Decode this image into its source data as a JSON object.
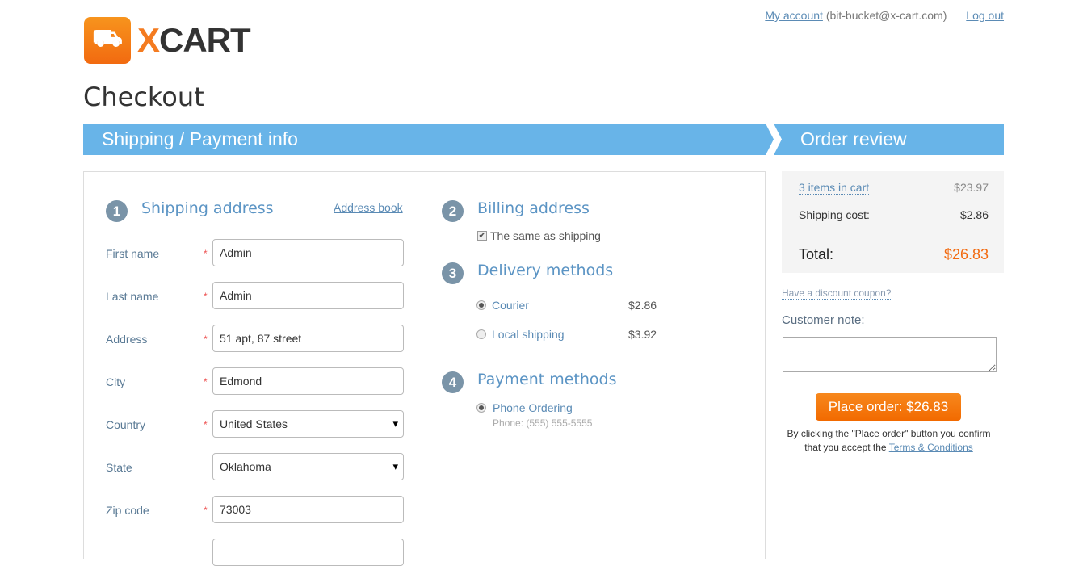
{
  "header": {
    "my_account": "My account",
    "email": "(bit-bucket@x-cart.com)",
    "logout": "Log out",
    "logo_x": "X",
    "logo_cart": "CART"
  },
  "page_title": "Checkout",
  "steps": {
    "step1": "Shipping / Payment info",
    "step2": "Order review"
  },
  "shipping": {
    "num": "1",
    "title": "Shipping address",
    "address_book": "Address book",
    "fields": [
      {
        "label": "First name",
        "value": "Admin",
        "required": true
      },
      {
        "label": "Last name",
        "value": "Admin",
        "required": true
      },
      {
        "label": "Address",
        "value": "51 apt, 87 street",
        "required": true
      },
      {
        "label": "City",
        "value": "Edmond",
        "required": true
      },
      {
        "label": "Country",
        "value": "United States",
        "required": true
      },
      {
        "label": "State",
        "value": "Oklahoma",
        "required": false
      },
      {
        "label": "Zip code",
        "value": "73003",
        "required": true
      }
    ],
    "req_mark": "*"
  },
  "billing": {
    "num": "2",
    "title": "Billing address",
    "same": "The same as shipping"
  },
  "delivery": {
    "num": "3",
    "title": "Delivery methods",
    "options": [
      {
        "label": "Courier",
        "price": "$2.86",
        "selected": true
      },
      {
        "label": "Local shipping",
        "price": "$3.92",
        "selected": false
      }
    ]
  },
  "payment": {
    "num": "4",
    "title": "Payment methods",
    "option": "Phone Ordering",
    "note": "Phone: (555) 555-5555"
  },
  "summary": {
    "items": "3 items in cart",
    "items_price": "$23.97",
    "shipping_label": "Shipping cost:",
    "shipping_price": "$2.86",
    "total_label": "Total:",
    "total": "$26.83"
  },
  "coupon": "Have a discount coupon?",
  "note_label": "Customer note:",
  "place_order": "Place order: $26.83",
  "confirm_text": "By clicking the \"Place order\" button you confirm",
  "confirm_text2": "that you accept the",
  "terms": "Terms & Conditions"
}
